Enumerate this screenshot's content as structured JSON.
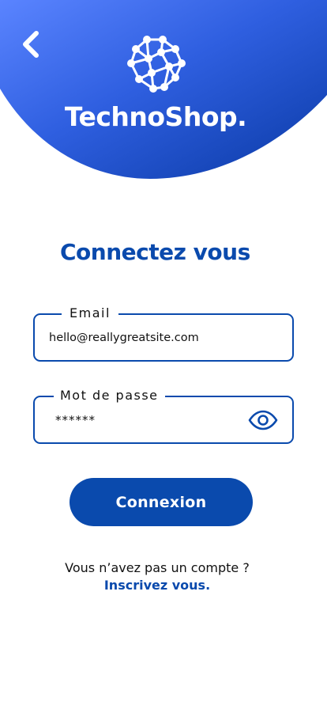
{
  "header": {
    "brand": "TechnoShop.",
    "back_icon": "chevron-left-icon",
    "logo_icon": "network-globe-icon",
    "gradient_start": "#4f7cff",
    "gradient_end": "#0a3ba8"
  },
  "login": {
    "title": "Connectez vous",
    "email_label": "Email",
    "email_value": "hello@reallygreatsite.com",
    "password_label": "Mot de passe",
    "password_value": "******",
    "eye_icon": "eye-icon",
    "submit_label": "Connexion",
    "no_account_text": "Vous n’avez pas un compte ?",
    "signup_link": "Inscrivez vous."
  },
  "colors": {
    "primary": "#0a4aad",
    "text": "#111111",
    "background": "#ffffff"
  }
}
